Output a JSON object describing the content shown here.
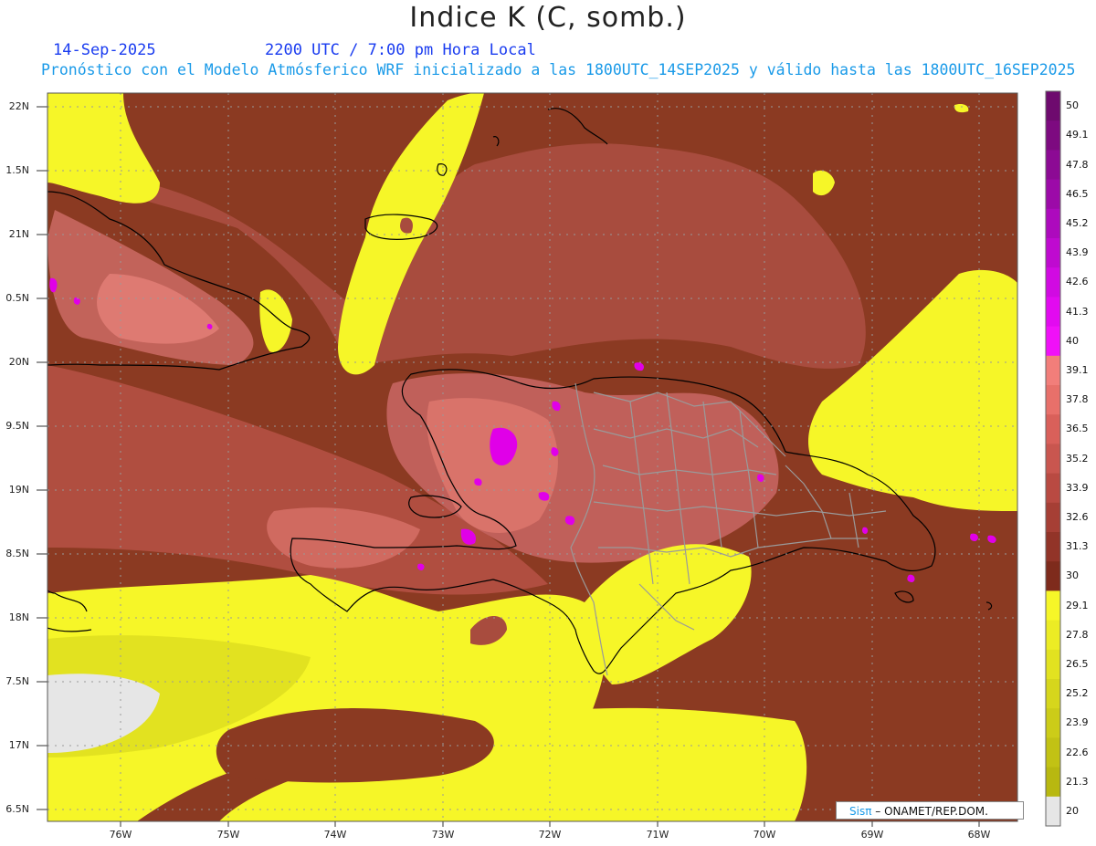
{
  "title": "Indice K (C, somb.)",
  "date": "14-Sep-2025",
  "time": "2200 UTC / 7:00 pm Hora Local",
  "forecast_line": "Pronóstico con el Modelo Atmósferico WRF inicializado a las 1800UTC_14SEP2025 y válido hasta las  1800UTC_16SEP2025",
  "lat_labels": [
    "22N",
    "1.5N",
    "21N",
    "0.5N",
    "20N",
    "9.5N",
    "19N",
    "8.5N",
    "18N",
    "7.5N",
    "17N",
    "6.5N"
  ],
  "lon_labels": [
    "76W",
    "75W",
    "74W",
    "73W",
    "72W",
    "71W",
    "70W",
    "69W",
    "68W"
  ],
  "colorbar": {
    "labels": [
      "50",
      "49.1",
      "47.8",
      "46.5",
      "45.2",
      "43.9",
      "42.6",
      "41.3",
      "40",
      "39.1",
      "37.8",
      "36.5",
      "35.2",
      "33.9",
      "32.6",
      "31.3",
      "30",
      "29.1",
      "27.8",
      "26.5",
      "25.2",
      "23.9",
      "22.6",
      "21.3",
      "20"
    ],
    "colors": [
      "#6e0a6e",
      "#7d0a80",
      "#8c0a94",
      "#9c0aa8",
      "#ad0abd",
      "#bf0ad0",
      "#d10ae2",
      "#e20af0",
      "#f010f8",
      "#f27e7a",
      "#e8706a",
      "#d9605a",
      "#c9564f",
      "#b94a42",
      "#a63f35",
      "#923428",
      "#7e2b1c",
      "#f6f628",
      "#ecec24",
      "#e2e220",
      "#d6d61c",
      "#cccc18",
      "#c2c214",
      "#b8b810",
      "#e6e6e6"
    ]
  },
  "credit": {
    "sis": "Sis",
    "pi": "π",
    "text": " – ONAMET/REP.DOM."
  },
  "colors": {
    "brown": "#8b3a22",
    "mid": "#b9574a",
    "salmon": "#e07a6e",
    "yellow": "#f6f628",
    "magenta": "#e000e8",
    "grey": "#e6e6e6"
  }
}
